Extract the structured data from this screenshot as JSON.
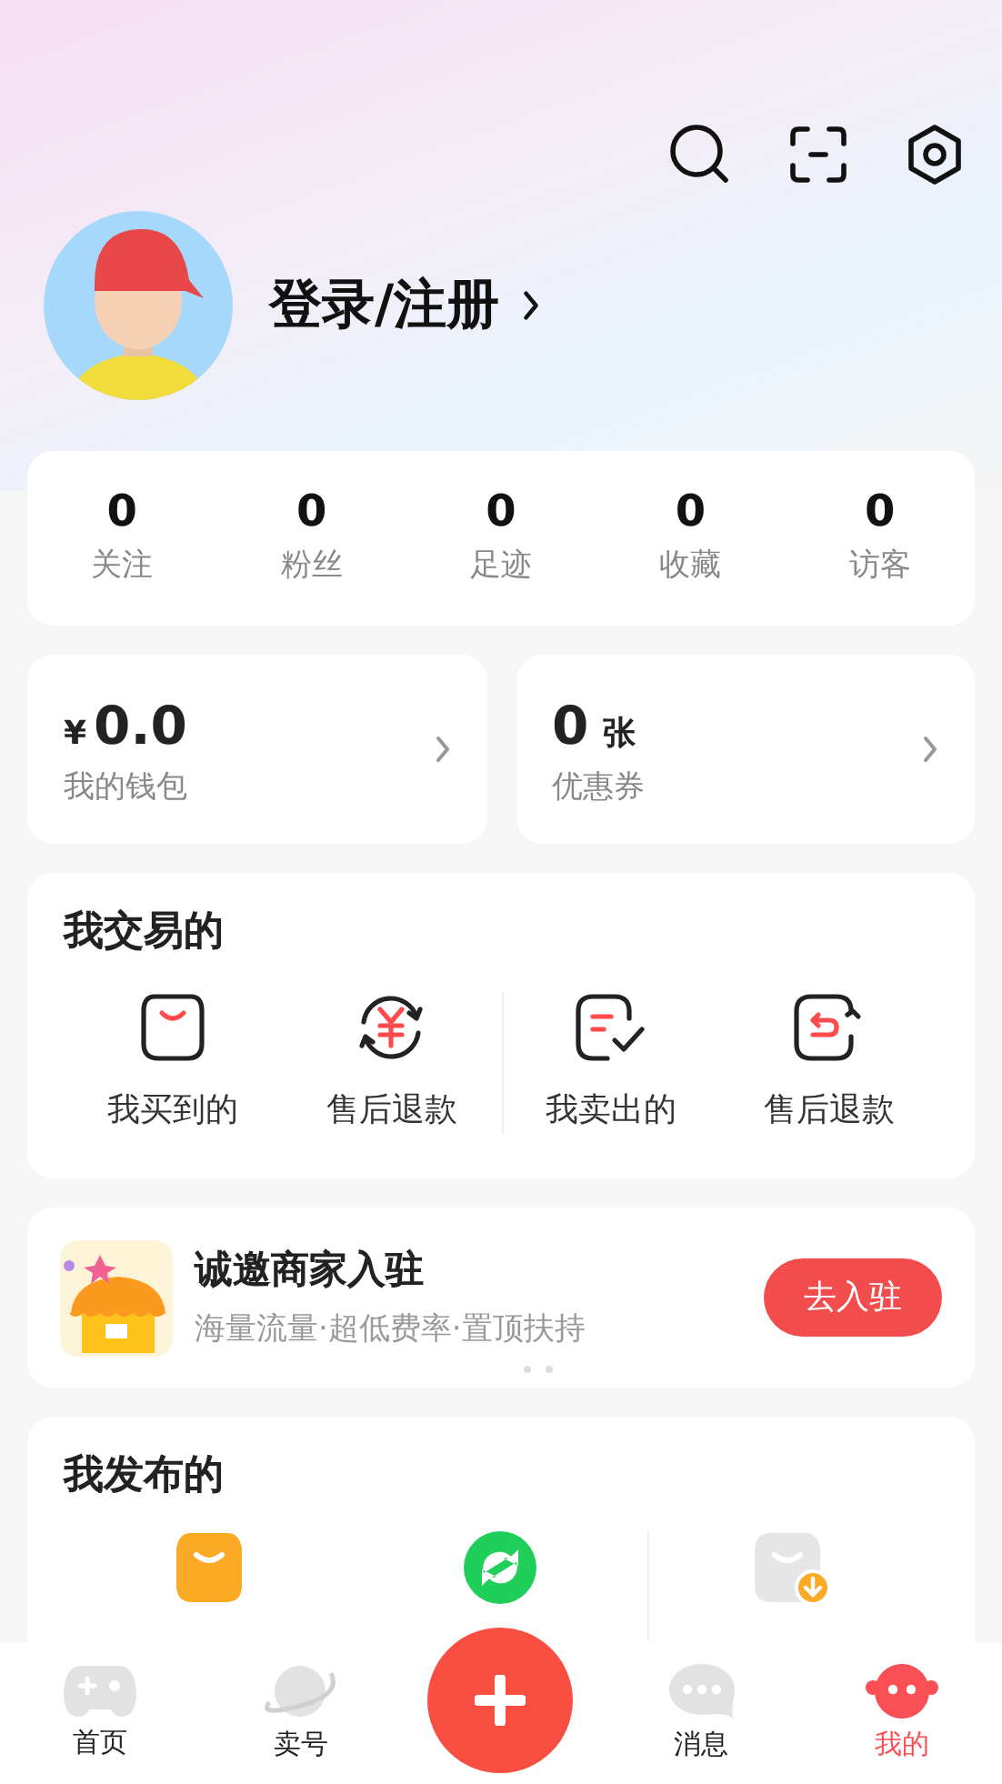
{
  "profile": {
    "login": "登录/注册"
  },
  "stats": [
    {
      "value": "0",
      "label": "关注"
    },
    {
      "value": "0",
      "label": "粉丝"
    },
    {
      "value": "0",
      "label": "足迹"
    },
    {
      "value": "0",
      "label": "收藏"
    },
    {
      "value": "0",
      "label": "访客"
    }
  ],
  "wallet": {
    "currency": "¥",
    "amount": "0.0",
    "label": "我的钱包"
  },
  "coupon": {
    "amount": "0",
    "unit": "张",
    "label": "优惠券"
  },
  "trades": {
    "title": "我交易的",
    "items": [
      {
        "label": "我买到的",
        "kind": "bag"
      },
      {
        "label": "售后退款",
        "kind": "refund"
      },
      {
        "label": "我卖出的",
        "kind": "sold"
      },
      {
        "label": "售后退款",
        "kind": "return"
      }
    ]
  },
  "banner": {
    "title": "诚邀商家入驻",
    "subtitle": "海量流量·超低费率·置顶扶持",
    "button": "去入驻"
  },
  "published": {
    "title": "我发布的",
    "items": [
      {
        "kind": "on_sale"
      },
      {
        "kind": "refresh"
      },
      {
        "kind": "off_shelf"
      }
    ]
  },
  "nav": [
    {
      "label": "首页",
      "kind": "game",
      "selected": false
    },
    {
      "label": "卖号",
      "kind": "planet",
      "selected": false
    },
    {
      "kind": "plus"
    },
    {
      "label": "消息",
      "kind": "chat",
      "selected": false
    },
    {
      "label": "我的",
      "kind": "me",
      "selected": true
    }
  ]
}
